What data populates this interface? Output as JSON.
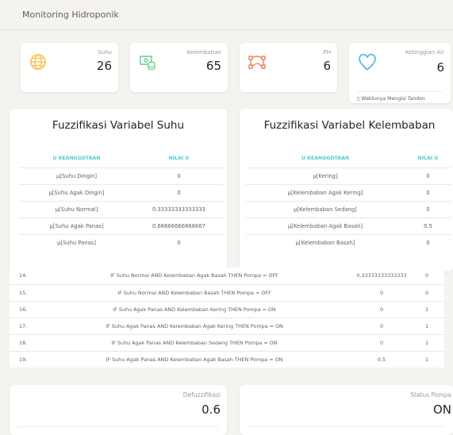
{
  "header": {
    "title": "Monitoring Hidroponik"
  },
  "stats": [
    {
      "label": "Suhu",
      "value": "26",
      "icon": "globe-icon"
    },
    {
      "label": "Kelembaban",
      "value": "65",
      "icon": "money-icon"
    },
    {
      "label": "PH",
      "value": "6",
      "icon": "vector-icon"
    },
    {
      "label": "Ketinggian Air",
      "value": "6",
      "icon": "heart-icon",
      "note": "Waktunya Mengisi Tandon"
    }
  ],
  "suhu_panel": {
    "title": "Fuzzifikasi Variabel Suhu",
    "headers": [
      "U KEANGGOTAAN",
      "NILAI U"
    ],
    "rows": [
      [
        "μ[Suhu Dingin]",
        "0"
      ],
      [
        "μ[Suhu Agak Dingin]",
        "0"
      ],
      [
        "μ[Suhu Normal]",
        "0.33333333333333"
      ],
      [
        "μ[Suhu Agak Panas]",
        "0.66666666666667"
      ],
      [
        "μ[Suhu Panas]",
        "0"
      ]
    ]
  },
  "kelembaban_panel": {
    "title": "Fuzzifikasi Variabel Kelembaban",
    "headers": [
      "U KEANGGOTAAN",
      "NILAI U"
    ],
    "rows": [
      [
        "μ[Kering]",
        "0"
      ],
      [
        "μ[Kelembaban Agak Kering]",
        "0"
      ],
      [
        "μ[Kelembaban Sedang]",
        "0"
      ],
      [
        "μ[Kelembaban Agak Basah]",
        "0.5"
      ],
      [
        "μ[Kelembaban Basah]",
        "0"
      ]
    ]
  },
  "rules": [
    {
      "no": "14.",
      "text": "IF Suhu Normal AND Kelembaban Agak Basah THEN Pompa = OFF",
      "v1": "0.33333333333333",
      "v2": "0"
    },
    {
      "no": "15.",
      "text": "IF Suhu Normal AND Kelembaban Basah THEN Pompa = OFF",
      "v1": "0",
      "v2": "0"
    },
    {
      "no": "16.",
      "text": "IF Suhu Agak Panas AND Kelembaban Kering THEN Pompa = ON",
      "v1": "0",
      "v2": "1"
    },
    {
      "no": "17.",
      "text": "IF Suhu Agak Panas AND Kelembaban Agak Kering THEN Pompa = ON",
      "v1": "0",
      "v2": "1"
    },
    {
      "no": "18.",
      "text": "IF Suhu Agak Panas AND Kelembaban Sedang THEN Pompa = ON",
      "v1": "0",
      "v2": "1"
    },
    {
      "no": "19.",
      "text": "IF Suhu Agak Panas AND Kelembaban Agak Basah THEN Pompa = ON",
      "v1": "0.5",
      "v2": "1"
    }
  ],
  "outputs": {
    "defuzzifikasi": {
      "label": "Defuzzifikasi",
      "value": "0.6"
    },
    "status_pompa": {
      "label": "Status Pompa",
      "value": "ON"
    }
  },
  "colors": {
    "accent": "#51cbce",
    "warning": "#fbc658",
    "success": "#6bd098",
    "danger": "#ef8157",
    "info": "#51bcda"
  }
}
